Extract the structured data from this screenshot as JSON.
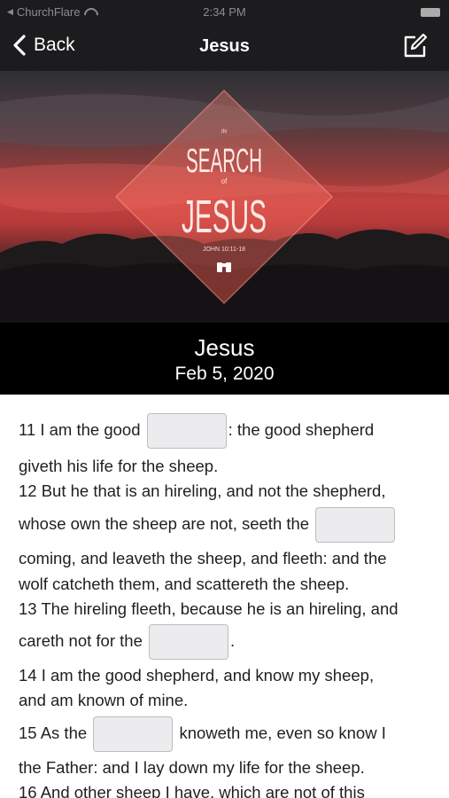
{
  "status_bar": {
    "carrier": "ChurchFlare",
    "time": "2:34 PM"
  },
  "nav": {
    "back_label": "Back",
    "title": "Jesus"
  },
  "hero": {
    "line1": "SEARCH",
    "small1": "of",
    "line2": "JESUS",
    "reference": "JOHN 10:11-18"
  },
  "header": {
    "title": "Jesus",
    "date": "Feb 5, 2020"
  },
  "passage": {
    "v11a": "11  I am the good",
    "v11b": ": the good shepherd",
    "v11c": "giveth his life for the sheep.",
    "v12a": "12  But he that is an hireling, and not the shepherd,",
    "v12b": "whose own the sheep are not, seeth the",
    "v12c": "coming, and leaveth the sheep, and fleeth: and the",
    "v12d": "wolf catcheth them, and scattereth the sheep.",
    "v13a": "13  The hireling fleeth, because he is an hireling, and",
    "v13b": "careth not for the",
    "v13c": ".",
    "v14a": "14  I am the good shepherd, and know my sheep,",
    "v14b": "and am known of mine.",
    "v15a": "15  As the",
    "v15b": "knoweth me, even so know I",
    "v15c": "the Father: and I lay down my life for the sheep.",
    "v16a": "16  And other sheep I have, which are not of this"
  },
  "colors": {
    "bar": "#1c1c1e",
    "band": "#000000",
    "blank_fill": "#ececee"
  }
}
